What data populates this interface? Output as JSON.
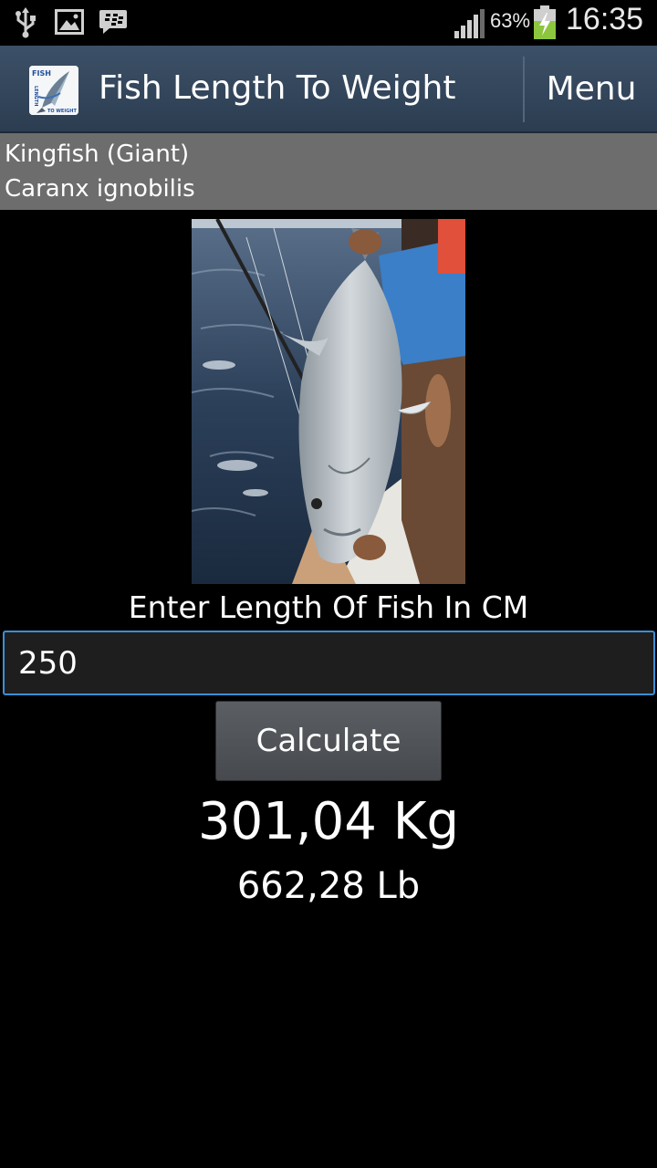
{
  "status_bar": {
    "icons": [
      "usb-icon",
      "gallery-icon",
      "bbm-icon",
      "signal-icon",
      "battery-charging-icon"
    ],
    "battery_percent": "63%",
    "time": "16:35"
  },
  "action_bar": {
    "title": "Fish Length To Weight",
    "menu_label": "Menu",
    "logo_text_top": "FISH",
    "logo_text_side": "LENGTH",
    "logo_text_bottom": "TO WEIGHT"
  },
  "species": {
    "common_name": "Kingfish (Giant)",
    "latin_name": "Caranx ignobilis"
  },
  "form": {
    "length_label": "Enter Length Of Fish In CM",
    "length_value": "250",
    "calculate_label": "Calculate"
  },
  "result": {
    "kg": "301,04 Kg",
    "lb": "662,28 Lb"
  },
  "colors": {
    "action_bar": "#34475c",
    "species_panel": "#6d6d6d",
    "input_focus": "#3a8fd6"
  }
}
